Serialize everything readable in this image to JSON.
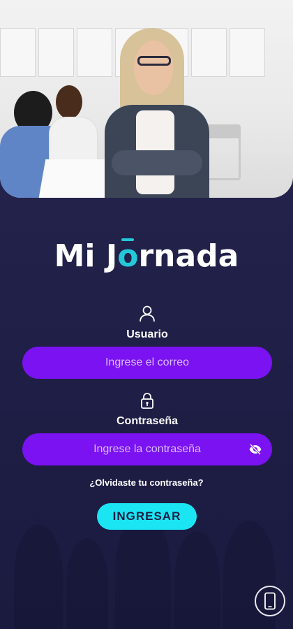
{
  "app": {
    "logo_text_before": "Mi J",
    "logo_o": "o",
    "logo_text_after": "rnada",
    "brand_colors": {
      "primary_purple": "#7a12f2",
      "accent_cyan": "#1be5f2",
      "background": "#1f1f47"
    }
  },
  "hero": {
    "icon": "office-team-photo"
  },
  "user_field": {
    "label": "Usuario",
    "placeholder": "Ingrese el correo",
    "icon": "user-icon"
  },
  "password_field": {
    "label": "Contraseña",
    "placeholder": "Ingrese la contraseña",
    "icon": "lock-icon",
    "toggle_icon": "eye-hidden-icon"
  },
  "forgot_link": "¿Olvidaste tu contraseña?",
  "submit_label": "INGRESAR",
  "device_button": {
    "icon": "phone-icon"
  }
}
